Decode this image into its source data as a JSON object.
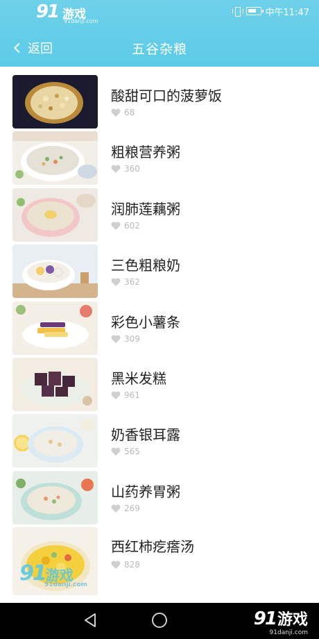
{
  "status_bar": {
    "logo_main": "91",
    "logo_cn": "游戏",
    "logo_domain": "91danji.com",
    "time": "中午11:47"
  },
  "nav": {
    "back_label": "返回",
    "title": "五谷杂粮"
  },
  "items": [
    {
      "title": "酸甜可口的菠萝饭",
      "likes": "68",
      "thumb": "pineapple-rice"
    },
    {
      "title": "粗粮营养粥",
      "likes": "360",
      "thumb": "porridge"
    },
    {
      "title": "润肺莲藕粥",
      "likes": "602",
      "thumb": "lotus-porridge"
    },
    {
      "title": "三色粗粮奶",
      "likes": "362",
      "thumb": "tricolor-milk"
    },
    {
      "title": "彩色小薯条",
      "likes": "309",
      "thumb": "sweet-potato-fries"
    },
    {
      "title": "黑米发糕",
      "likes": "961",
      "thumb": "black-rice-cake"
    },
    {
      "title": "奶香银耳露",
      "likes": "565",
      "thumb": "tremella-dessert"
    },
    {
      "title": "山药养胃粥",
      "likes": "269",
      "thumb": "yam-porridge"
    },
    {
      "title": "西红柿疙瘩汤",
      "likes": "828",
      "thumb": "tomato-soup"
    }
  ],
  "watermark": {
    "main": "91",
    "cn": "游戏",
    "domain": "91danji.com"
  },
  "colors": {
    "header": "#5ccbe7",
    "like_gray": "#b9b9b9",
    "title_text": "#222222"
  }
}
